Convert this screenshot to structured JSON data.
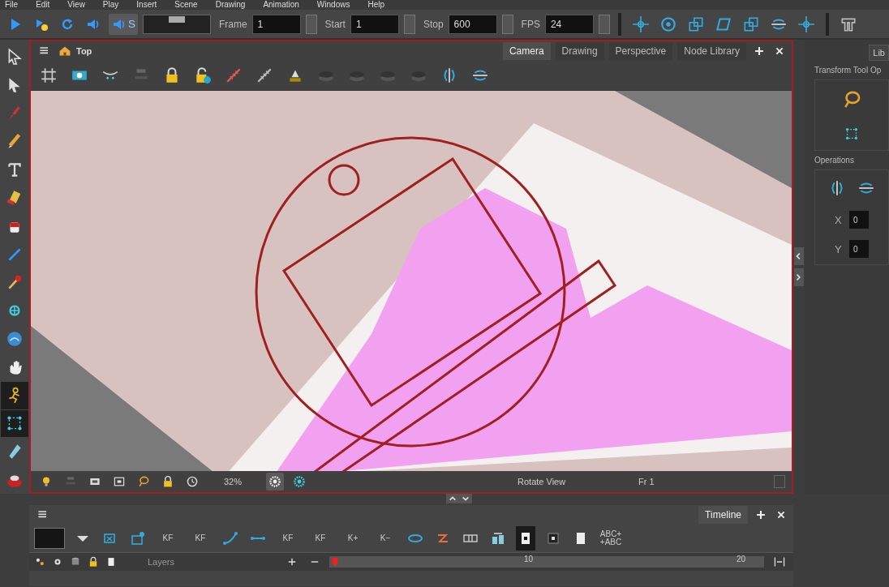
{
  "menu": [
    "File",
    "Edit",
    "View",
    "Play",
    "Insert",
    "Scene",
    "Drawing",
    "Animation",
    "Windows",
    "Help"
  ],
  "play_buttons": [
    {
      "selected": false
    },
    {
      "selected": false
    },
    {
      "selected": false
    },
    {
      "selected": false
    },
    {
      "label": "S",
      "selected": true
    }
  ],
  "scrub": {
    "level": 0.5
  },
  "fields": [
    {
      "label": "Frame",
      "value": "1"
    },
    {
      "label": "Start",
      "value": "1"
    },
    {
      "label": "Stop",
      "value": "600"
    },
    {
      "label": "FPS",
      "value": "24"
    }
  ],
  "tools": [
    {
      "selected": false
    },
    {
      "selected": false
    },
    {
      "selected": false
    },
    {
      "selected": false
    },
    {
      "selected": false
    },
    {
      "selected": false
    },
    {
      "selected": false
    },
    {
      "selected": false
    },
    {
      "selected": false
    },
    {
      "selected": false
    },
    {
      "selected": false
    },
    {
      "selected": false
    },
    {
      "selected": true
    },
    {
      "selected": true
    },
    {
      "selected": false
    },
    {
      "selected": false
    }
  ],
  "camera_view": {
    "title": "Top",
    "tabs": [
      {
        "label": "Camera",
        "selected": true
      },
      {
        "label": "Drawing",
        "selected": false
      },
      {
        "label": "Perspective",
        "selected": false
      },
      {
        "label": "Node Library",
        "selected": false
      }
    ],
    "zoom": "32%",
    "status": "Rotate View",
    "frame": "Fr 1"
  },
  "right_panel": {
    "tab": "Lib",
    "title": "Transform Tool Op",
    "operations": "Operations",
    "x": {
      "label": "X",
      "value": "0"
    },
    "y": {
      "label": "Y",
      "value": "0"
    }
  },
  "timeline": {
    "tab": "Timeline",
    "tools": [
      {
        "kind": "icon",
        "selected": false
      },
      {
        "kind": "icon",
        "selected": false
      },
      {
        "kind": "icon",
        "selected": false
      },
      {
        "kind": "text",
        "label": "KF",
        "selected": false
      },
      {
        "kind": "text",
        "label": "KF",
        "selected": false
      },
      {
        "kind": "icon",
        "selected": false
      },
      {
        "kind": "icon",
        "selected": false
      },
      {
        "kind": "text",
        "label": "KF",
        "selected": false
      },
      {
        "kind": "text",
        "label": "KF",
        "selected": false
      },
      {
        "kind": "text",
        "label": "K+",
        "selected": false
      },
      {
        "kind": "text",
        "label": "K−",
        "selected": false
      },
      {
        "kind": "icon",
        "selected": false
      },
      {
        "kind": "icon",
        "selected": false
      },
      {
        "kind": "icon",
        "selected": false
      },
      {
        "kind": "icon",
        "selected": false
      },
      {
        "kind": "icon",
        "selected": true
      },
      {
        "kind": "icon",
        "selected": false
      },
      {
        "kind": "icon",
        "selected": false
      },
      {
        "kind": "text",
        "label": "ABC+ +ABC",
        "selected": false
      }
    ],
    "layers": "Layers",
    "ruler": [
      "10",
      "20"
    ]
  }
}
